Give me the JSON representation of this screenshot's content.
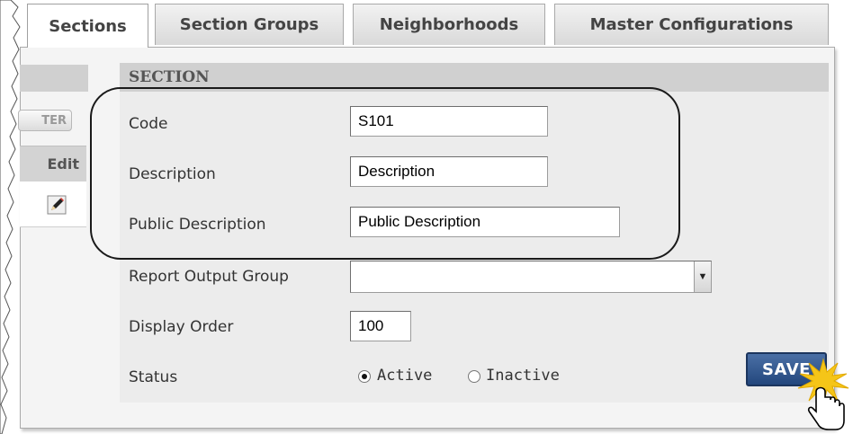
{
  "tabs": [
    {
      "label": "Sections",
      "active": true
    },
    {
      "label": "Section Groups",
      "active": false
    },
    {
      "label": "Neighborhoods",
      "active": false
    },
    {
      "label": "Master Configurations",
      "active": false
    }
  ],
  "sidebar": {
    "filter_label": "TER",
    "edit_label": "Edit",
    "edit_icon": "pencil-icon"
  },
  "form": {
    "header": "SECTION",
    "fields": {
      "code": {
        "label": "Code",
        "value": "S101"
      },
      "description": {
        "label": "Description",
        "value": "Description"
      },
      "public_description": {
        "label": "Public Description",
        "value": "Public Description"
      },
      "report_output_group": {
        "label": "Report Output Group",
        "value": ""
      },
      "display_order": {
        "label": "Display Order",
        "value": "100"
      },
      "status": {
        "label": "Status",
        "options": [
          "Active",
          "Inactive"
        ],
        "selected": "Active"
      }
    },
    "save_label": "SAVE"
  },
  "colors": {
    "save_button": "#2e5288",
    "section_header": "#d0d0d0",
    "burst": "#f5c518"
  }
}
